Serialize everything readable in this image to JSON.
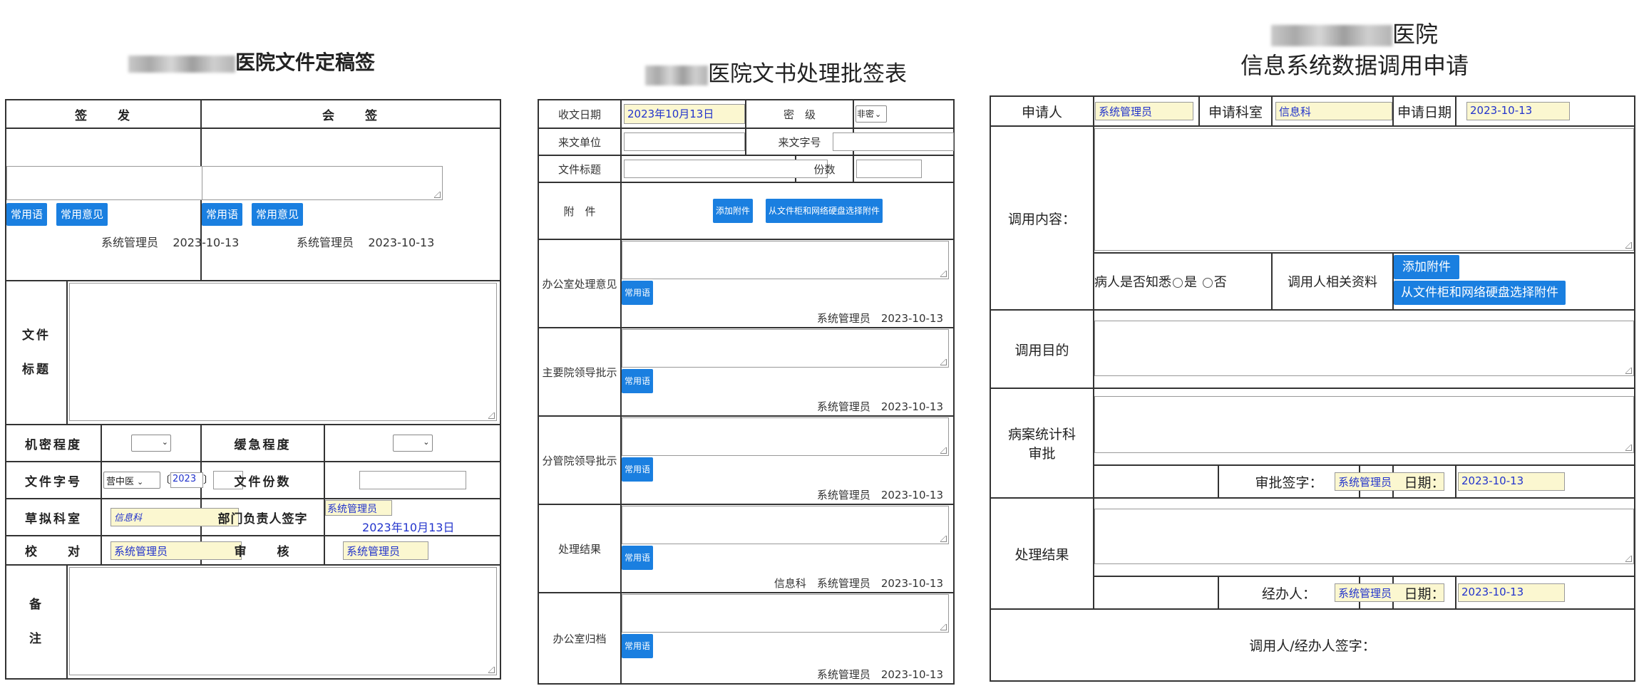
{
  "titles": {
    "form1": "医院文件定稿签",
    "form2": "医院文书处理批签表",
    "form3_line1": "医院",
    "form3_line2": "信息系统数据调用申请"
  },
  "common": {
    "phrase_btn": "常用语",
    "opinion_btn": "常用意见",
    "user": "系统管理员",
    "date": "2023-10-13",
    "date_cn": "2023年10月13日",
    "dept": "信息科"
  },
  "form1": {
    "issue": "签　　发",
    "countersign": "会　　签",
    "doc_title_1": "文件",
    "doc_title_2": "标题",
    "secrecy": "机密程度",
    "urgency": "缓急程度",
    "doc_no": "文件字号",
    "doc_no_prefix": "营中医",
    "doc_no_year": "2023",
    "paren_open": "〔",
    "paren_close": "〕",
    "copies": "文件份数",
    "draft_dept": "草拟科室",
    "draft_dept_value": "信息科",
    "dept_head": "部门负责人签字",
    "proofread": "校　　对",
    "review": "审　　核",
    "remark_1": "备",
    "remark_2": "注"
  },
  "form2": {
    "recv_date": "收文日期",
    "secrecy": "密　级",
    "secrecy_value": "非密",
    "from_unit": "来文单位",
    "from_no": "来文字号",
    "doc_title": "文件标题",
    "copies": "份数",
    "attachment": "附　件",
    "add_attachment": "添加附件",
    "choose_attachment": "从文件柜和网络硬盘选择附件",
    "rows": [
      {
        "label": "办公室处理意见",
        "sign": "系统管理员　2023-10-13"
      },
      {
        "label": "主要院领导批示",
        "sign": "系统管理员　2023-10-13"
      },
      {
        "label": "分管院领导批示",
        "sign": "系统管理员　2023-10-13"
      },
      {
        "label": "处理结果",
        "sign": "信息科　系统管理员　2023-10-13"
      },
      {
        "label": "办公室归档",
        "sign": "系统管理员　2023-10-13"
      }
    ]
  },
  "form3": {
    "applicant": "申请人",
    "apply_dept": "申请科室",
    "apply_date": "申请日期",
    "content": "调用内容：",
    "patient_informed": "病人是否知悉",
    "yes": "是",
    "no": "否",
    "related_docs": "调用人相关资料",
    "add_attachment": "添加附件",
    "choose_attachment": "从文件柜和网络硬盘选择附件",
    "purpose": "调用目的",
    "stat_approve_1": "病案统计科",
    "stat_approve_2": "审批",
    "approve_sign": "审批签字：",
    "date_label": "日期：",
    "result": "处理结果",
    "handler": "经办人：",
    "signatures": "调用人/经办人签字："
  }
}
